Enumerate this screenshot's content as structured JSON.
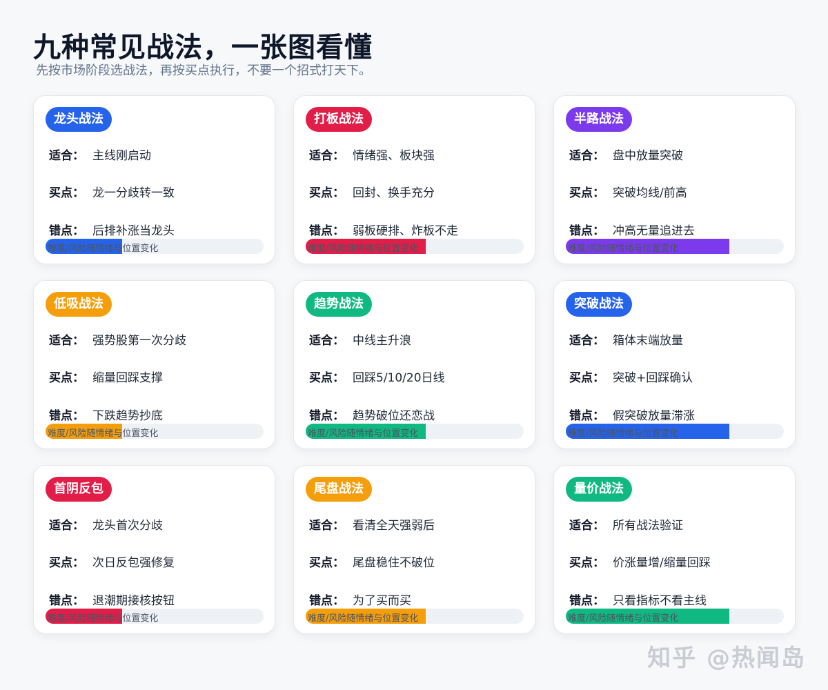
{
  "header": {
    "title": "九种常见战法，一张图看懂",
    "subtitle": "先按市场阶段选战法，再按买点执行，不要一个招式打天下。"
  },
  "cards": [
    {
      "tag": "龙头战法",
      "color": "#2563eb",
      "fit_label": "适合：",
      "fit": "主线刚启动",
      "buy_label": "买点：",
      "buy": "龙一分歧转一致",
      "wrong_label": "错点：",
      "wrong": "后排补涨当龙头",
      "bar_label": "难度/风险随情绪与位置变化",
      "level": 0.35
    },
    {
      "tag": "打板战法",
      "color": "#e11d48",
      "fit_label": "适合：",
      "fit": "情绪强、板块强",
      "buy_label": "买点：",
      "buy": "回封、换手充分",
      "wrong_label": "错点：",
      "wrong": "弱板硬排、炸板不走",
      "bar_label": "难度/风险随情绪与位置变化",
      "level": 0.55
    },
    {
      "tag": "半路战法",
      "color": "#7c3aed",
      "fit_label": "适合：",
      "fit": "盘中放量突破",
      "buy_label": "买点：",
      "buy": "突破均线/前高",
      "wrong_label": "错点：",
      "wrong": "冲高无量追进去",
      "bar_label": "难度/风险随情绪与位置变化",
      "level": 0.75
    },
    {
      "tag": "低吸战法",
      "color": "#f59e0b",
      "fit_label": "适合：",
      "fit": "强势股第一次分歧",
      "buy_label": "买点：",
      "buy": "缩量回踩支撑",
      "wrong_label": "错点：",
      "wrong": "下跌趋势抄底",
      "bar_label": "难度/风险随情绪与位置变化",
      "level": 0.35
    },
    {
      "tag": "趋势战法",
      "color": "#10b981",
      "fit_label": "适合：",
      "fit": "中线主升浪",
      "buy_label": "买点：",
      "buy": "回踩5/10/20日线",
      "wrong_label": "错点：",
      "wrong": "趋势破位还恋战",
      "bar_label": "难度/风险随情绪与位置变化",
      "level": 0.55
    },
    {
      "tag": "突破战法",
      "color": "#2563eb",
      "fit_label": "适合：",
      "fit": "箱体末端放量",
      "buy_label": "买点：",
      "buy": "突破+回踩确认",
      "wrong_label": "错点：",
      "wrong": "假突破放量滞涨",
      "bar_label": "难度/风险随情绪与位置变化",
      "level": 0.75
    },
    {
      "tag": "首阴反包",
      "color": "#e11d48",
      "fit_label": "适合：",
      "fit": "龙头首次分歧",
      "buy_label": "买点：",
      "buy": "次日反包强修复",
      "wrong_label": "错点：",
      "wrong": "退潮期接核按钮",
      "bar_label": "难度/风险随情绪与位置变化",
      "level": 0.35
    },
    {
      "tag": "尾盘战法",
      "color": "#f59e0b",
      "fit_label": "适合：",
      "fit": "看清全天强弱后",
      "buy_label": "买点：",
      "buy": "尾盘稳住不破位",
      "wrong_label": "错点：",
      "wrong": "为了买而买",
      "bar_label": "难度/风险随情绪与位置变化",
      "level": 0.55
    },
    {
      "tag": "量价战法",
      "color": "#10b981",
      "fit_label": "适合：",
      "fit": "所有战法验证",
      "buy_label": "买点：",
      "buy": "价涨量增/缩量回踩",
      "wrong_label": "错点：",
      "wrong": "只看指标不看主线",
      "bar_label": "难度/风险随情绪与位置变化",
      "level": 0.75
    }
  ],
  "watermark": "知乎 @热闻岛"
}
